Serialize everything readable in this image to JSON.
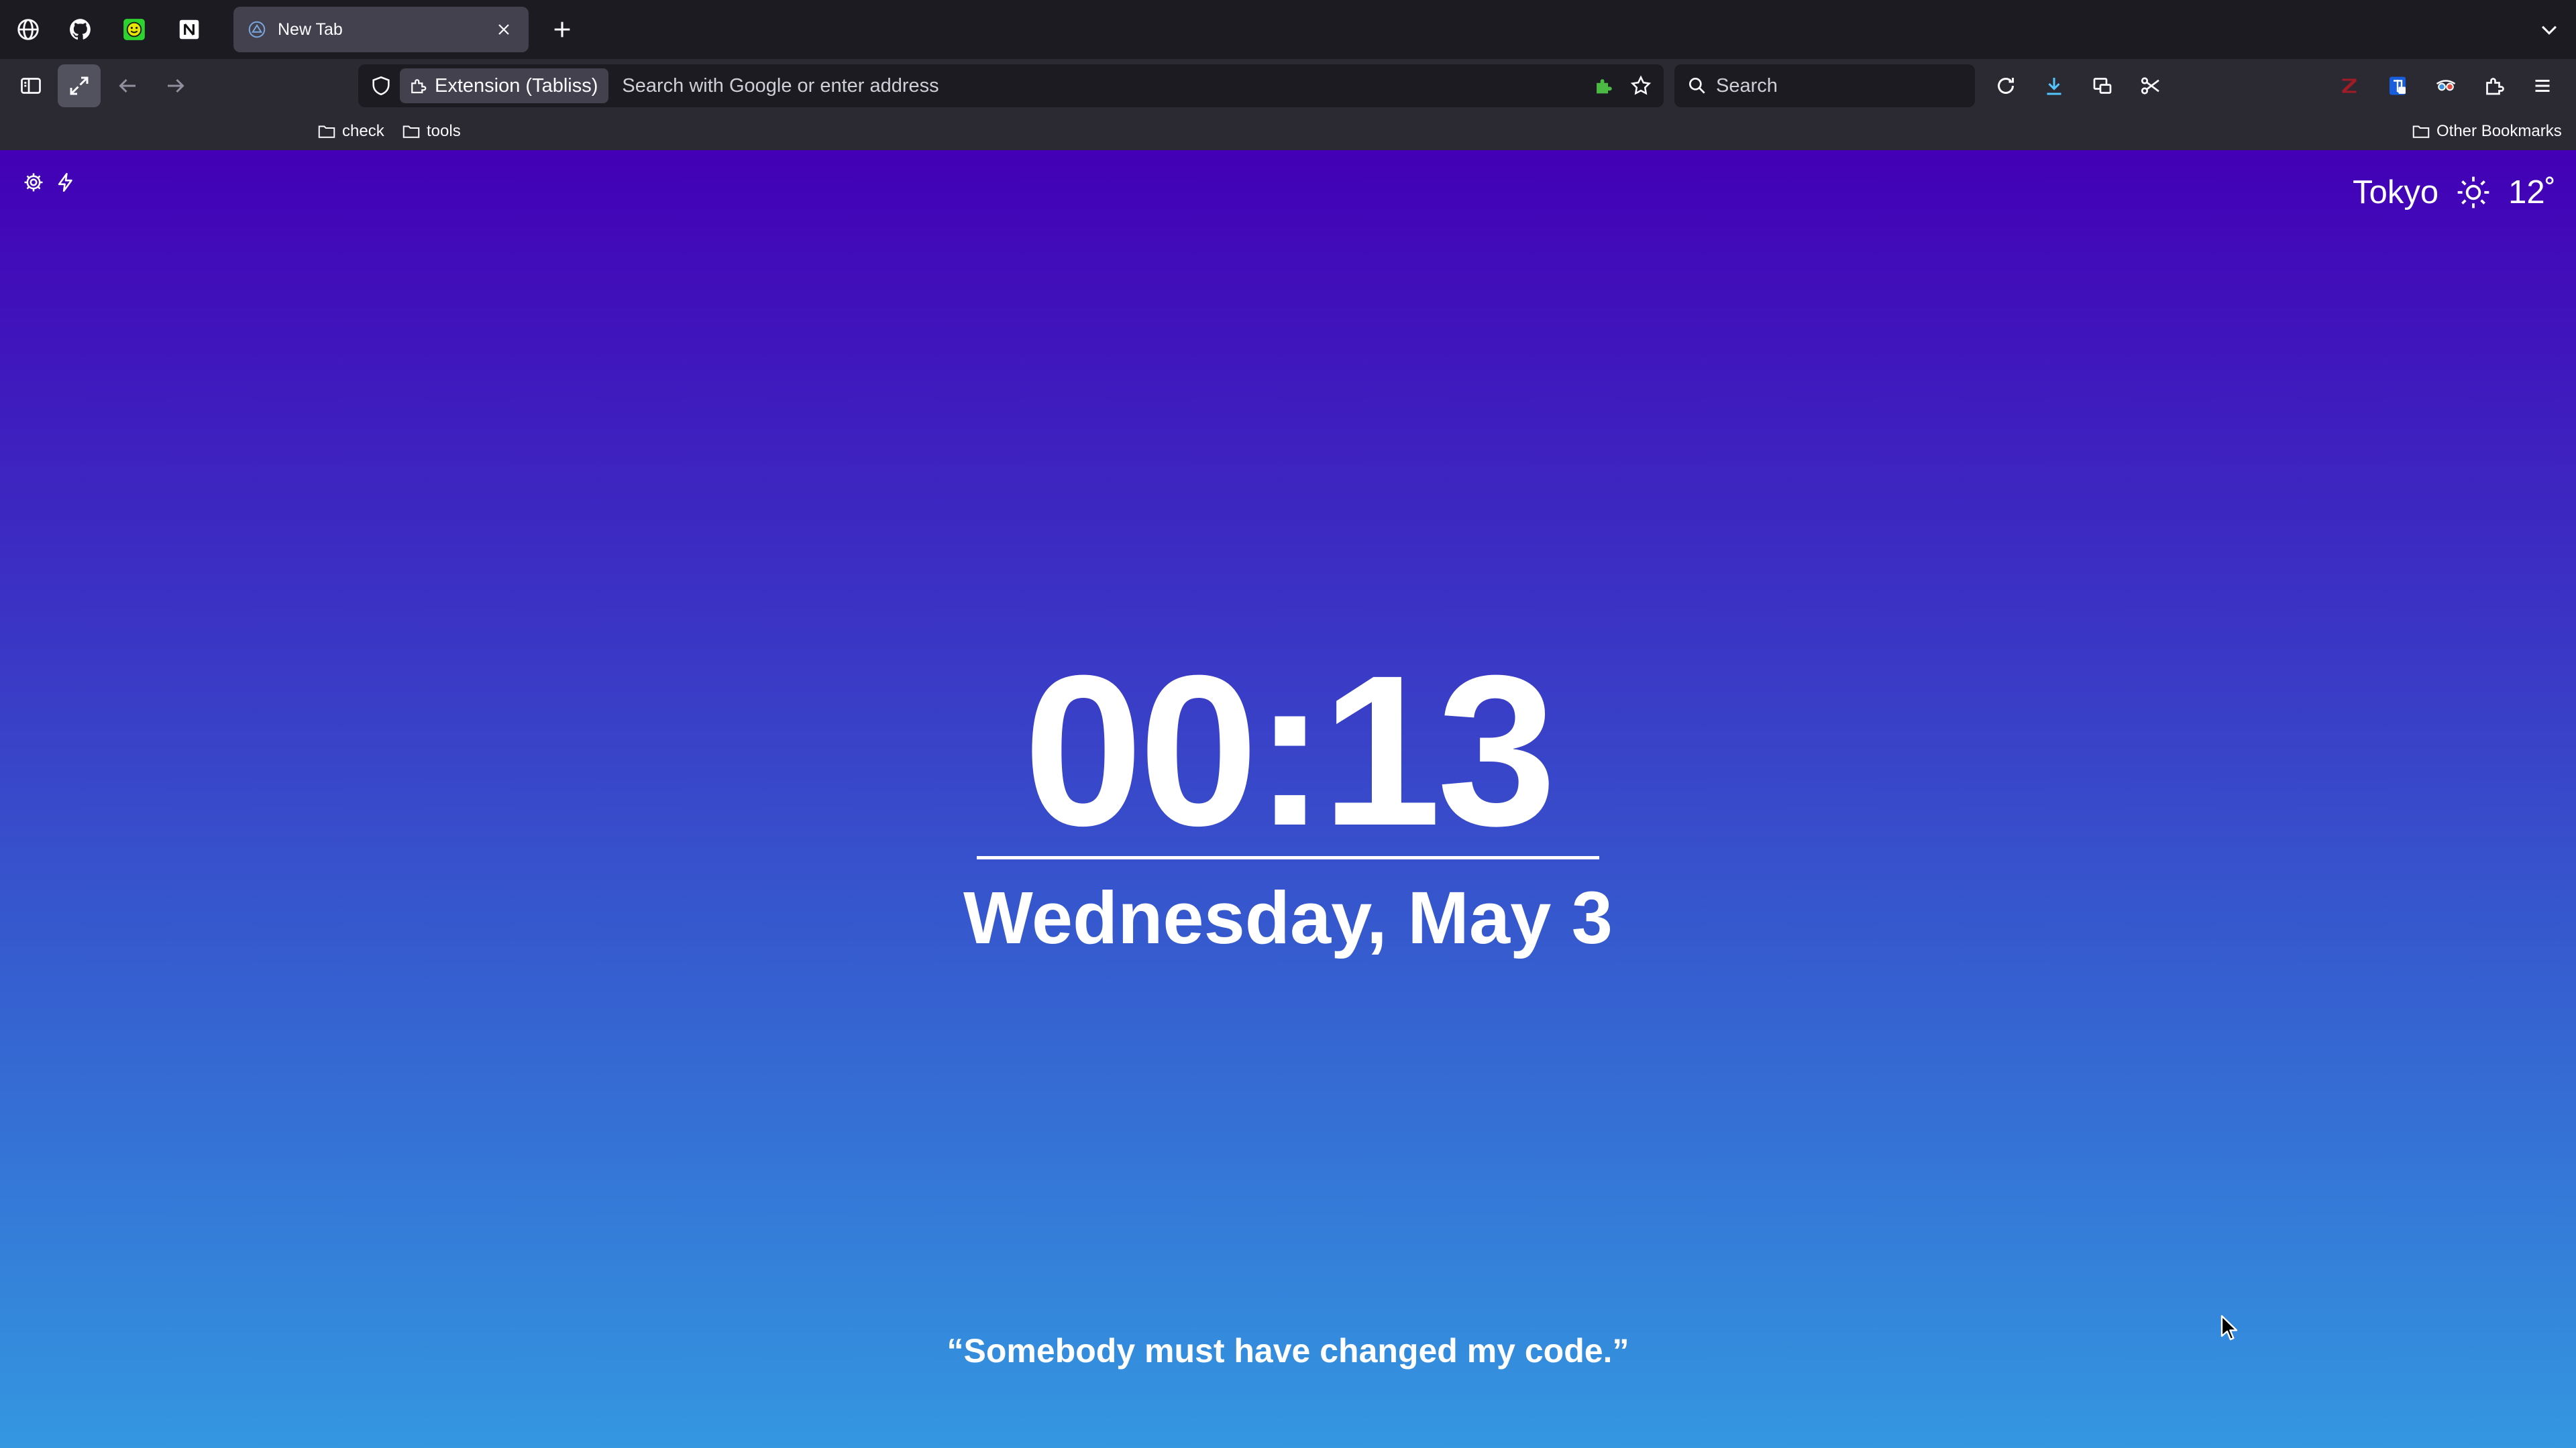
{
  "browser": {
    "pinned_tabs": [
      {
        "icon": "globe-icon"
      },
      {
        "icon": "github-icon"
      },
      {
        "icon": "smiley-app-icon"
      },
      {
        "icon": "notion-icon"
      }
    ],
    "active_tab": {
      "title": "New Tab",
      "icon": "tabliss-icon"
    },
    "urlbar": {
      "identity_label": "Extension (Tabliss)",
      "placeholder": "Search with Google or enter address"
    },
    "searchbar": {
      "placeholder": "Search"
    },
    "bookmarks": [
      {
        "label": "check"
      },
      {
        "label": "tools"
      }
    ],
    "other_bookmarks": "Other Bookmarks"
  },
  "page": {
    "weather": {
      "city": "Tokyo",
      "temperature": "12˚",
      "condition_icon": "sun-icon"
    },
    "time": "00:13",
    "date": "Wednesday, May 3",
    "quote": "“Somebody must have changed my code.”"
  },
  "colors": {
    "gradient_top": "#4300b6",
    "gradient_bottom": "#3497e0",
    "toolbar_bg": "#2b2a33",
    "tabstrip_bg": "#1c1b22",
    "accent_download": "#54c6ff",
    "accent_extension_green": "#4cb944"
  }
}
